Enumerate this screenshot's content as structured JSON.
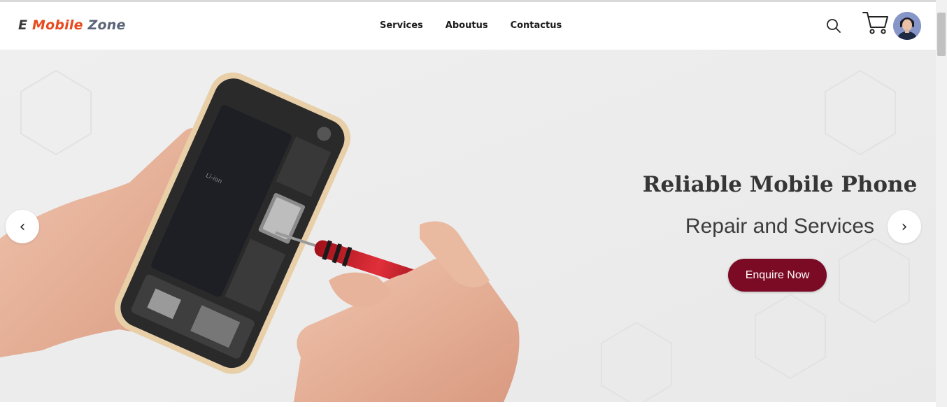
{
  "brand": {
    "part1": "E",
    "part2": "Mobile",
    "part3": "Zone"
  },
  "nav": {
    "items": [
      {
        "label": "Services"
      },
      {
        "label": "Aboutus"
      },
      {
        "label": "Contactus"
      }
    ]
  },
  "header_icons": {
    "search": "search-icon",
    "cart": "cart-icon",
    "avatar": "user-avatar"
  },
  "hero": {
    "title": "Reliable Mobile Phone",
    "subtitle": "Repair and Services",
    "cta_label": "Enquire Now",
    "prev_arrow": "‹",
    "next_arrow": "›"
  },
  "colors": {
    "brand_dark": "#3a3a3a",
    "brand_accent": "#e8491d",
    "brand_slate": "#5a6478",
    "cta": "#7b0b24"
  }
}
